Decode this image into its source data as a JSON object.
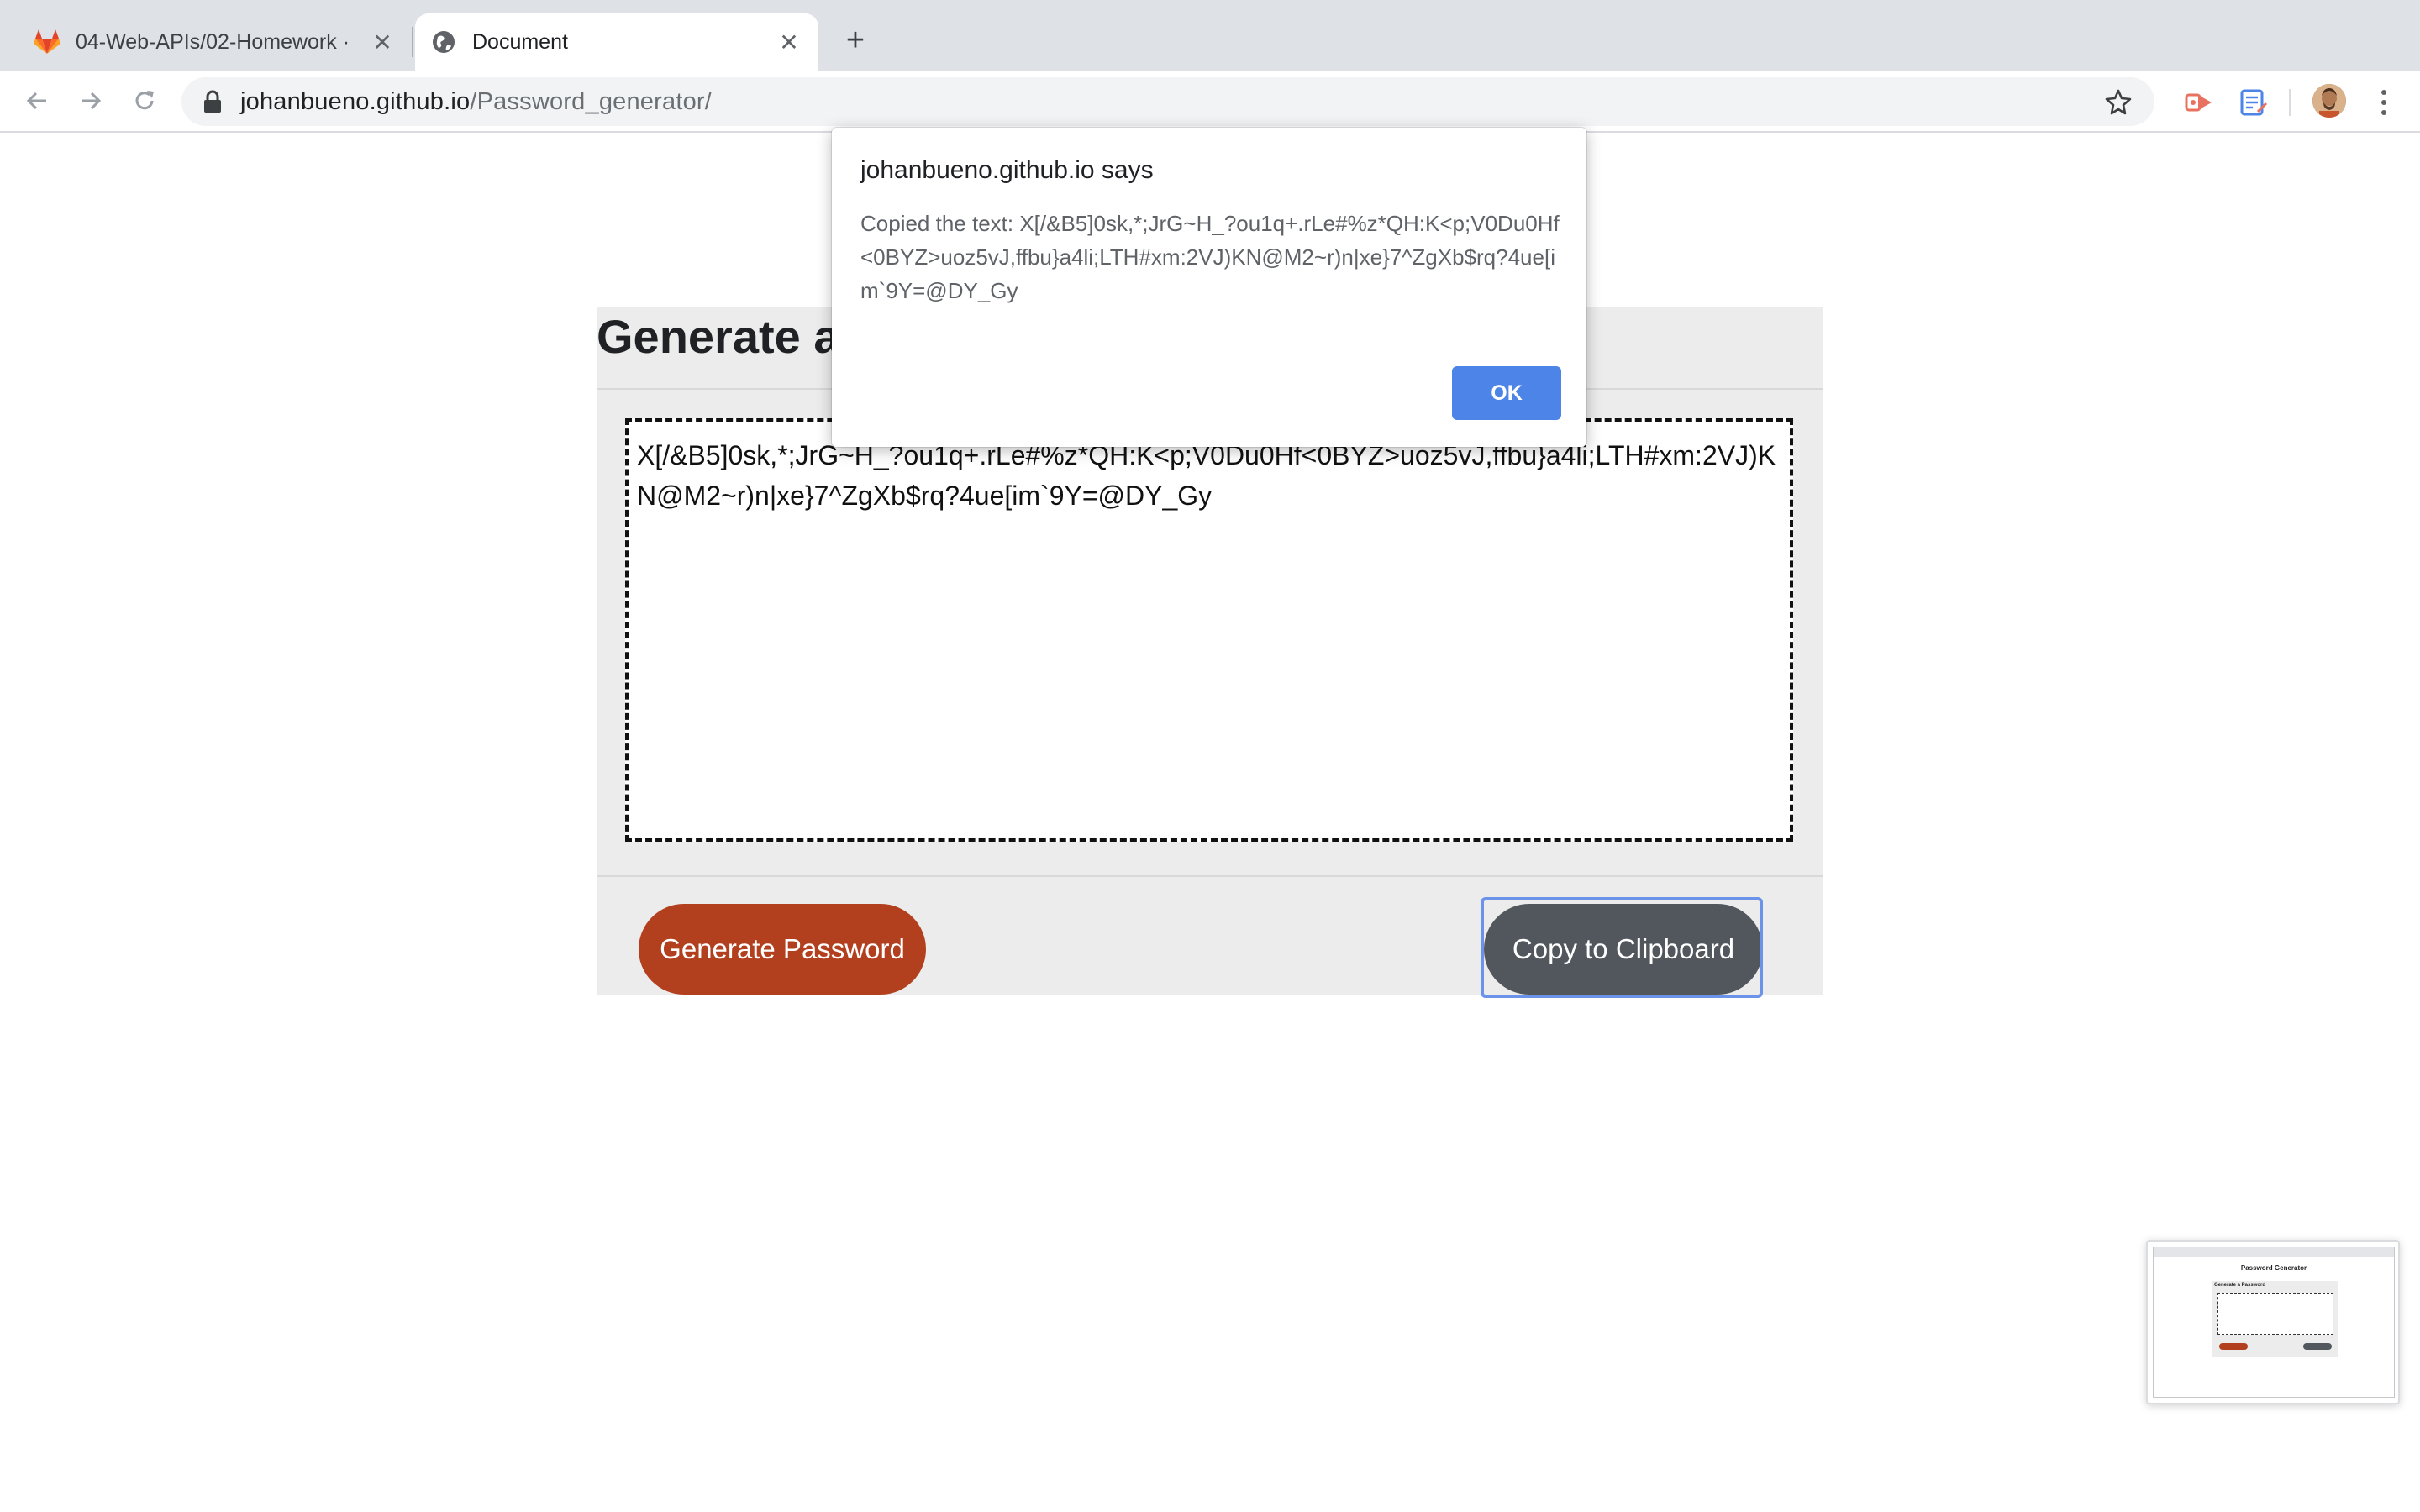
{
  "browser": {
    "tabs": [
      {
        "title": "04-Web-APIs/02-Homework · ",
        "active": false,
        "icon": "gitlab-icon"
      },
      {
        "title": "Document",
        "active": true,
        "icon": "globe-icon"
      }
    ],
    "new_tab_symbol": "+",
    "close_symbol": "✕",
    "url": {
      "host": "johanbueno.github.io",
      "path": "/Password_generator/"
    }
  },
  "page": {
    "title": "Generate a Password",
    "password": "X[/&B5]0sk,*;JrG~H_?ou1q+.rLe#%z*QH:K<p;V0Du0Hf<0BYZ>uoz5vJ,ffbu}a4li;LTH#xm:2VJ)KN@M2~r)n|xe}7^ZgXb$rq?4ue[im`9Y=@DY_Gy",
    "buttons": {
      "generate": "Generate Password",
      "copy": "Copy to Clipboard"
    }
  },
  "dialog": {
    "title": "johanbueno.github.io says",
    "message": "Copied the text: X[/&B5]0sk,*;JrG~H_?ou1q+.rLe#%z*QH:K<p;V0Du0Hf<0BYZ>uoz5vJ,ffbu}a4li;LTH#xm:2VJ)KN@M2~r)n|xe}7^ZgXb$rq?4ue[im`9Y=@DY_Gy",
    "ok_label": "OK"
  },
  "thumbnail": {
    "title": "Password Generator",
    "card_title": "Generate a Password"
  },
  "colors": {
    "generate_button": "#b2401f",
    "copy_button": "#52575d",
    "dialog_ok": "#4d84e8",
    "card_background": "#ececec"
  }
}
